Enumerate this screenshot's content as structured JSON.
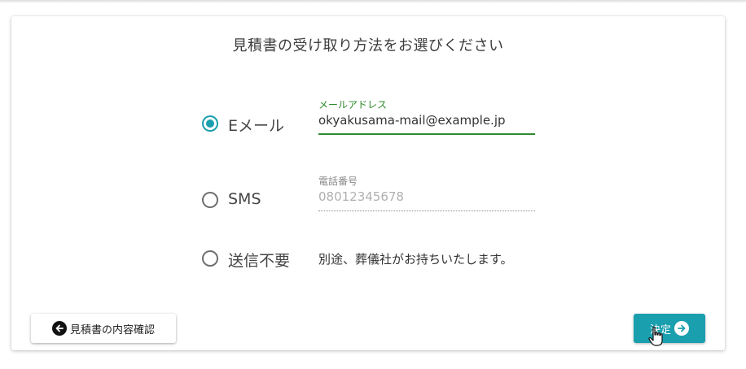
{
  "title": "見積書の受け取り方法をお選びください",
  "options": [
    {
      "label": "Eメール",
      "selected": true,
      "field_label": "メールアドレス",
      "field_value": "okyakusama-mail@example.jp",
      "field_enabled": true
    },
    {
      "label": "SMS",
      "selected": false,
      "field_label": "電話番号",
      "field_value": "08012345678",
      "field_enabled": false
    },
    {
      "label": "送信不要",
      "selected": false,
      "note": "別途、葬儀社がお持ちいたします。"
    }
  ],
  "buttons": {
    "back_label": "見積書の内容確認",
    "back_icon": "arrow-left-circle-icon",
    "submit_label": "決定",
    "submit_icon": "arrow-right-circle-icon"
  },
  "colors": {
    "accent": "#1a9faf",
    "active_field": "#2e8b2e",
    "disabled_text": "#b0b0b0"
  }
}
